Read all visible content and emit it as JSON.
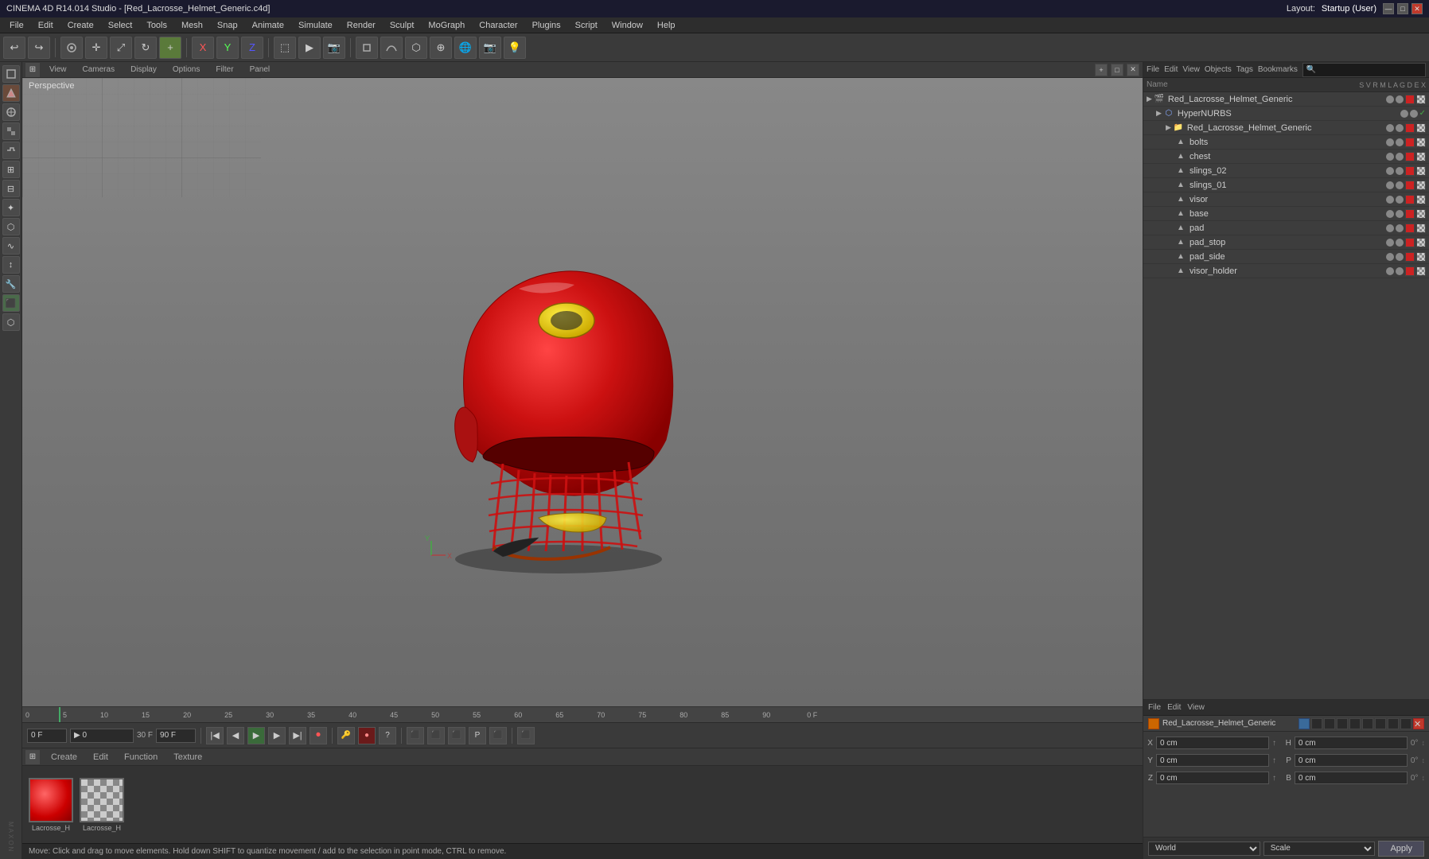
{
  "title_bar": {
    "title": "CINEMA 4D R14.014 Studio - [Red_Lacrosse_Helmet_Generic.c4d]",
    "layout_label": "Layout:",
    "layout_value": "Startup (User)",
    "min_btn": "—",
    "max_btn": "□",
    "close_btn": "✕"
  },
  "menu_bar": {
    "items": [
      "File",
      "Edit",
      "Create",
      "Select",
      "Tools",
      "Mesh",
      "Snap",
      "Animate",
      "Simulate",
      "Render",
      "Sculpt",
      "MoGraph",
      "Character",
      "Plugins",
      "Script",
      "Window",
      "Help"
    ]
  },
  "viewport": {
    "label": "Perspective",
    "tabs": [
      "View",
      "Cameras",
      "Display",
      "Options",
      "Filter",
      "Panel"
    ]
  },
  "timeline": {
    "ticks": [
      "0",
      "5",
      "10",
      "15",
      "20",
      "25",
      "30",
      "35",
      "40",
      "45",
      "50",
      "55",
      "60",
      "65",
      "70",
      "75",
      "80",
      "85",
      "90"
    ],
    "frame_label": "0 F",
    "end_frame": "0 F"
  },
  "transport": {
    "current_frame": "0 F",
    "fps": "30 F",
    "end_frame": "90 F"
  },
  "material_editor": {
    "tabs": [
      "Create",
      "Edit",
      "Function",
      "Texture"
    ],
    "materials": [
      {
        "name": "Lacrosse_H",
        "type": "red"
      },
      {
        "name": "Lacrosse_H",
        "type": "checker"
      }
    ]
  },
  "status_bar": {
    "text": "Move: Click and drag to move elements. Hold down SHIFT to quantize movement / add to the selection in point mode, CTRL to remove."
  },
  "object_manager": {
    "menus": [
      "File",
      "Edit",
      "View"
    ],
    "header": {
      "name_col": "Name",
      "cols": [
        "S",
        "V",
        "R",
        "M",
        "L",
        "A",
        "G",
        "D",
        "E",
        "X"
      ]
    },
    "objects": [
      {
        "name": "Red_Lacrosse_Helmet_Generic",
        "indent": 0,
        "icon": "🎬",
        "has_color": true,
        "has_checker": false,
        "level": 0
      },
      {
        "name": "HyperNURBS",
        "indent": 1,
        "icon": "⬡",
        "has_color": false,
        "has_checker": false,
        "level": 1,
        "has_check": true
      },
      {
        "name": "Red_Lacrosse_Helmet_Generic",
        "indent": 2,
        "icon": "📁",
        "has_color": true,
        "has_checker": false,
        "level": 2
      },
      {
        "name": "bolts",
        "indent": 3,
        "icon": "▲",
        "has_color": true,
        "has_checker": false,
        "level": 3
      },
      {
        "name": "chest",
        "indent": 3,
        "icon": "▲",
        "has_color": true,
        "has_checker": false,
        "level": 3
      },
      {
        "name": "slings_02",
        "indent": 3,
        "icon": "▲",
        "has_color": true,
        "has_checker": false,
        "level": 3
      },
      {
        "name": "slings_01",
        "indent": 3,
        "icon": "▲",
        "has_color": true,
        "has_checker": false,
        "level": 3
      },
      {
        "name": "visor",
        "indent": 3,
        "icon": "▲",
        "has_color": true,
        "has_checker": false,
        "level": 3
      },
      {
        "name": "base",
        "indent": 3,
        "icon": "▲",
        "has_color": true,
        "has_checker": false,
        "level": 3
      },
      {
        "name": "pad",
        "indent": 3,
        "icon": "▲",
        "has_color": true,
        "has_checker": false,
        "level": 3
      },
      {
        "name": "pad_stop",
        "indent": 3,
        "icon": "▲",
        "has_color": true,
        "has_checker": false,
        "level": 3
      },
      {
        "name": "pad_side",
        "indent": 3,
        "icon": "▲",
        "has_color": true,
        "has_checker": true,
        "level": 3
      },
      {
        "name": "visor_holder",
        "indent": 3,
        "icon": "▲",
        "has_color": true,
        "has_checker": true,
        "level": 3
      }
    ]
  },
  "attributes": {
    "menus": [
      "File",
      "Edit",
      "View"
    ],
    "selected_object": "Red_Lacrosse_Helmet_Generic",
    "coords": {
      "x_pos": "0 cm",
      "x_size": "0 cm",
      "y_pos": "0 cm",
      "y_size": "0 cm",
      "z_pos": "0 cm",
      "z_size": "0 cm",
      "h_rot": "0°",
      "p_rot": "0°",
      "b_rot": "0°"
    },
    "coord_system": "World",
    "mode": "Scale",
    "apply_label": "Apply"
  }
}
